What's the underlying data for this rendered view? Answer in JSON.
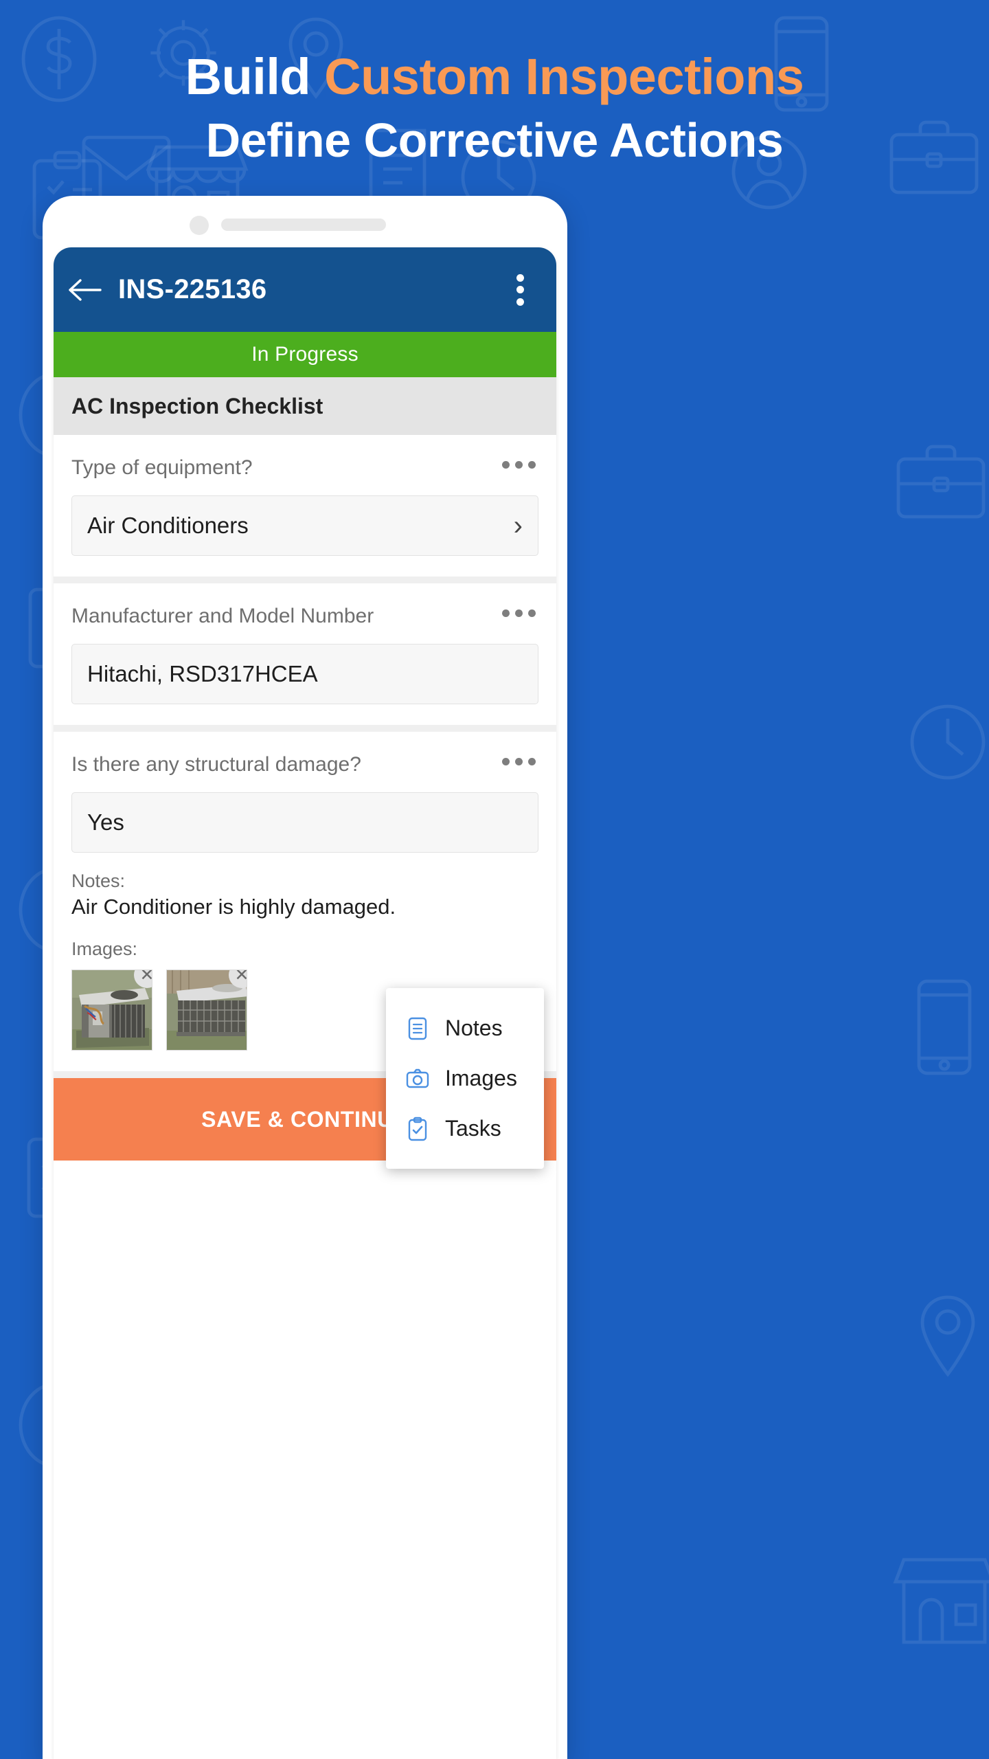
{
  "hero": {
    "line1_plain": "Build ",
    "line1_accent": "Custom Inspections",
    "line2": "Define Corrective Actions",
    "accent_color": "#F99A55",
    "background_color": "#1B5FC1"
  },
  "app": {
    "appbar": {
      "back_icon": "arrow-left-icon",
      "title": "INS-225136",
      "overflow_icon": "more-vertical-icon",
      "background_color": "#14528F"
    },
    "status": {
      "label": "In Progress",
      "color": "#4CAE1E"
    },
    "checklist_title": "AC Inspection Checklist",
    "questions": [
      {
        "label": "Type of equipment?",
        "value": "Air Conditioners",
        "field_type": "select",
        "chevron": "›",
        "menu_icon": "more-horizontal-icon"
      },
      {
        "label": "Manufacturer and Model Number",
        "value": "Hitachi, RSD317HCEA",
        "field_type": "text",
        "menu_icon": "more-horizontal-icon"
      },
      {
        "label": "Is there any structural damage?",
        "value": "Yes",
        "field_type": "select",
        "menu_icon": "more-horizontal-icon",
        "notes_label": "Notes:",
        "notes_text": "Air Conditioner is highly damaged.",
        "images_label": "Images:",
        "images": [
          {
            "alt": "damaged air conditioner unit open panel",
            "remove_icon": "close-icon"
          },
          {
            "alt": "damaged air conditioner unit side view",
            "remove_icon": "close-icon"
          }
        ]
      }
    ],
    "popup_menu": {
      "items": [
        {
          "label": "Notes",
          "icon": "notes-icon"
        },
        {
          "label": "Images",
          "icon": "camera-icon"
        },
        {
          "label": "Tasks",
          "icon": "clipboard-check-icon"
        }
      ],
      "icon_color": "#4A90E2"
    },
    "save_button": {
      "label": "SAVE & CONTINUE",
      "color": "#F5804F"
    }
  }
}
